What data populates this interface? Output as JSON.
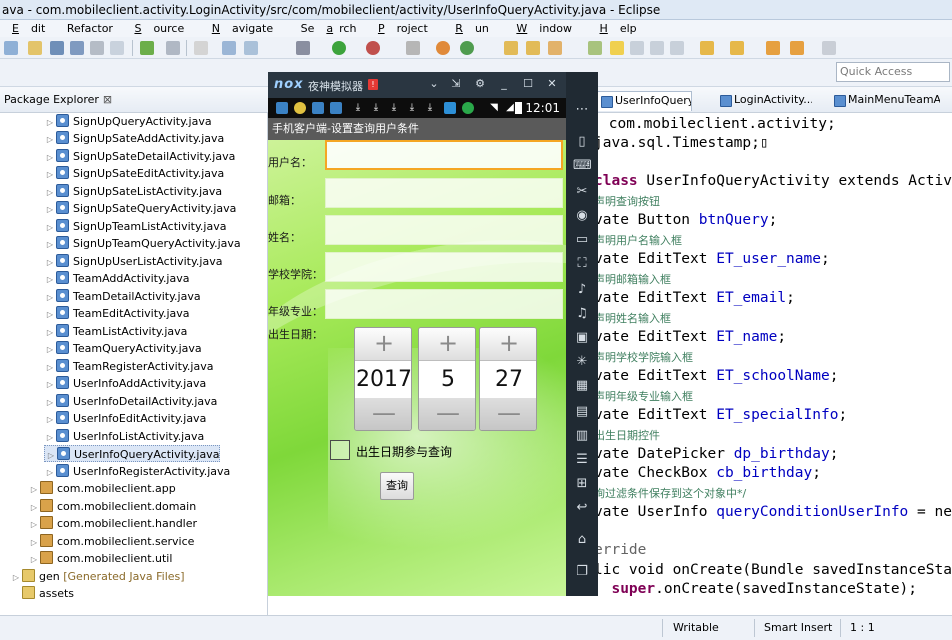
{
  "window": {
    "title": "ava - com.mobileclient.activity.LoginActivity/src/com/mobileclient/activity/UserInfoQueryActivity.java - Eclipse"
  },
  "menu": [
    {
      "label": "Edit",
      "mnemonic": "E",
      "rest": "dit"
    },
    {
      "label": "Refactor",
      "mnemonic": "",
      "rest": "Refactor"
    },
    {
      "label": "Source",
      "mnemonic": "S",
      "rest": "ource"
    },
    {
      "label": "Navigate",
      "mnemonic": "N",
      "rest": "avigate"
    },
    {
      "label": "Search",
      "mnemonic": "a",
      "rest": "Se"
    },
    {
      "label": "Project",
      "mnemonic": "P",
      "rest": "roject"
    },
    {
      "label": "Run",
      "mnemonic": "R",
      "rest": "un"
    },
    {
      "label": "Window",
      "mnemonic": "W",
      "rest": "indow"
    },
    {
      "label": "Help",
      "mnemonic": "H",
      "rest": "elp"
    }
  ],
  "quick_access": {
    "placeholder": "Quick Access"
  },
  "package_explorer": {
    "tab_label": "Package Explorer",
    "close": "⊠",
    "files": [
      "SignUpQueryActivity.java",
      "SignUpSateAddActivity.java",
      "SignUpSateDetailActivity.java",
      "SignUpSateEditActivity.java",
      "SignUpSateListActivity.java",
      "SignUpSateQueryActivity.java",
      "SignUpTeamListActivity.java",
      "SignUpTeamQueryActivity.java",
      "SignUpUserListActivity.java",
      "TeamAddActivity.java",
      "TeamDetailActivity.java",
      "TeamEditActivity.java",
      "TeamListActivity.java",
      "TeamQueryActivity.java",
      "TeamRegisterActivity.java",
      "UserInfoAddActivity.java",
      "UserInfoDetailActivity.java",
      "UserInfoEditActivity.java",
      "UserInfoListActivity.java",
      "UserInfoQueryActivity.java",
      "UserInfoRegisterActivity.java"
    ],
    "selected_file": "UserInfoQueryActivity.java",
    "packages": [
      "com.mobileclient.app",
      "com.mobileclient.domain",
      "com.mobileclient.handler",
      "com.mobileclient.service",
      "com.mobileclient.util"
    ],
    "gen_folder": "gen",
    "gen_sub": "[Generated Java Files]",
    "assets_folder": "assets"
  },
  "editor": {
    "tabs": [
      {
        "label": "UserInfoQuery...",
        "active": true
      },
      {
        "label": "LoginActivity....",
        "active": false
      },
      {
        "label": "MainMenuTeamA...",
        "active": false
      }
    ],
    "lines": [
      {
        "pre": "",
        "kw": "",
        "fld": "",
        "text": " com.mobileclient.activity;"
      },
      {
        "pre": "",
        "kw": "",
        "fld": "",
        "text": "java.sql.Timestamp;▯"
      },
      {
        "pre": "",
        "kw": "",
        "fld": "",
        "text": ""
      },
      {
        "pre": "",
        "kw": "class",
        "fld": "",
        "text": " UserInfoQueryActivity extends Activ"
      },
      {
        "comment": "声明查询按钮"
      },
      {
        "pre": "vate Button ",
        "kw": "",
        "fld": "btnQuery",
        "text": ";"
      },
      {
        "comment": "声明用户名输入框"
      },
      {
        "pre": "vate EditText ",
        "kw": "",
        "fld": "ET_user_name",
        "text": ";"
      },
      {
        "comment": "声明邮箱输入框"
      },
      {
        "pre": "vate EditText ",
        "kw": "",
        "fld": "ET_email",
        "text": ";"
      },
      {
        "comment": "声明姓名输入框"
      },
      {
        "pre": "vate EditText ",
        "kw": "",
        "fld": "ET_name",
        "text": ";"
      },
      {
        "comment": "声明学校学院输入框"
      },
      {
        "pre": "vate EditText ",
        "kw": "",
        "fld": "ET_schoolName",
        "text": ";"
      },
      {
        "comment": "声明年级专业输入框"
      },
      {
        "pre": "vate EditText ",
        "kw": "",
        "fld": "ET_specialInfo",
        "text": ";"
      },
      {
        "comment": "出生日期控件"
      },
      {
        "pre": "vate DatePicker ",
        "kw": "",
        "fld": "dp_birthday",
        "text": ";"
      },
      {
        "pre": "vate CheckBox ",
        "kw": "",
        "fld": "cb_birthday",
        "text": ";"
      },
      {
        "comment": "询过滤条件保存到这个对象中*/"
      },
      {
        "pre": "vate UserInfo ",
        "kw": "",
        "fld": "queryConditionUserInfo",
        "text": " = ne"
      },
      {
        "pre": "",
        "kw": "",
        "fld": "",
        "text": ""
      },
      {
        "ann": "erride"
      },
      {
        "pre": "lic void onCreate(Bundle savedInstanceSta",
        "kw": "",
        "fld": "",
        "text": ""
      },
      {
        "pre": "  ",
        "kw": "super",
        "fld": "",
        "text": ".onCreate(savedInstanceState);"
      }
    ]
  },
  "status_bar": {
    "writable": "Writable",
    "insert_mode": "Smart Insert",
    "position": "1 : 1"
  },
  "nox": {
    "logo": "nox",
    "name": "夜神模拟器",
    "badge": "!",
    "clock": "12:01",
    "app_title": "手机客户端-设置查询用户条件",
    "fields": [
      {
        "label": "用户名：",
        "value": ""
      },
      {
        "label": "邮箱：",
        "value": ""
      },
      {
        "label": "姓名：",
        "value": ""
      },
      {
        "label": "学校学院：",
        "value": ""
      },
      {
        "label": "年级专业：",
        "value": ""
      }
    ],
    "birthday_label": "出生日期：",
    "date": {
      "year": "2017",
      "month": "5",
      "day": "27",
      "plus": "+",
      "minus": "—"
    },
    "checkbox_label": "出生日期参与查询",
    "query_button": "查询"
  }
}
